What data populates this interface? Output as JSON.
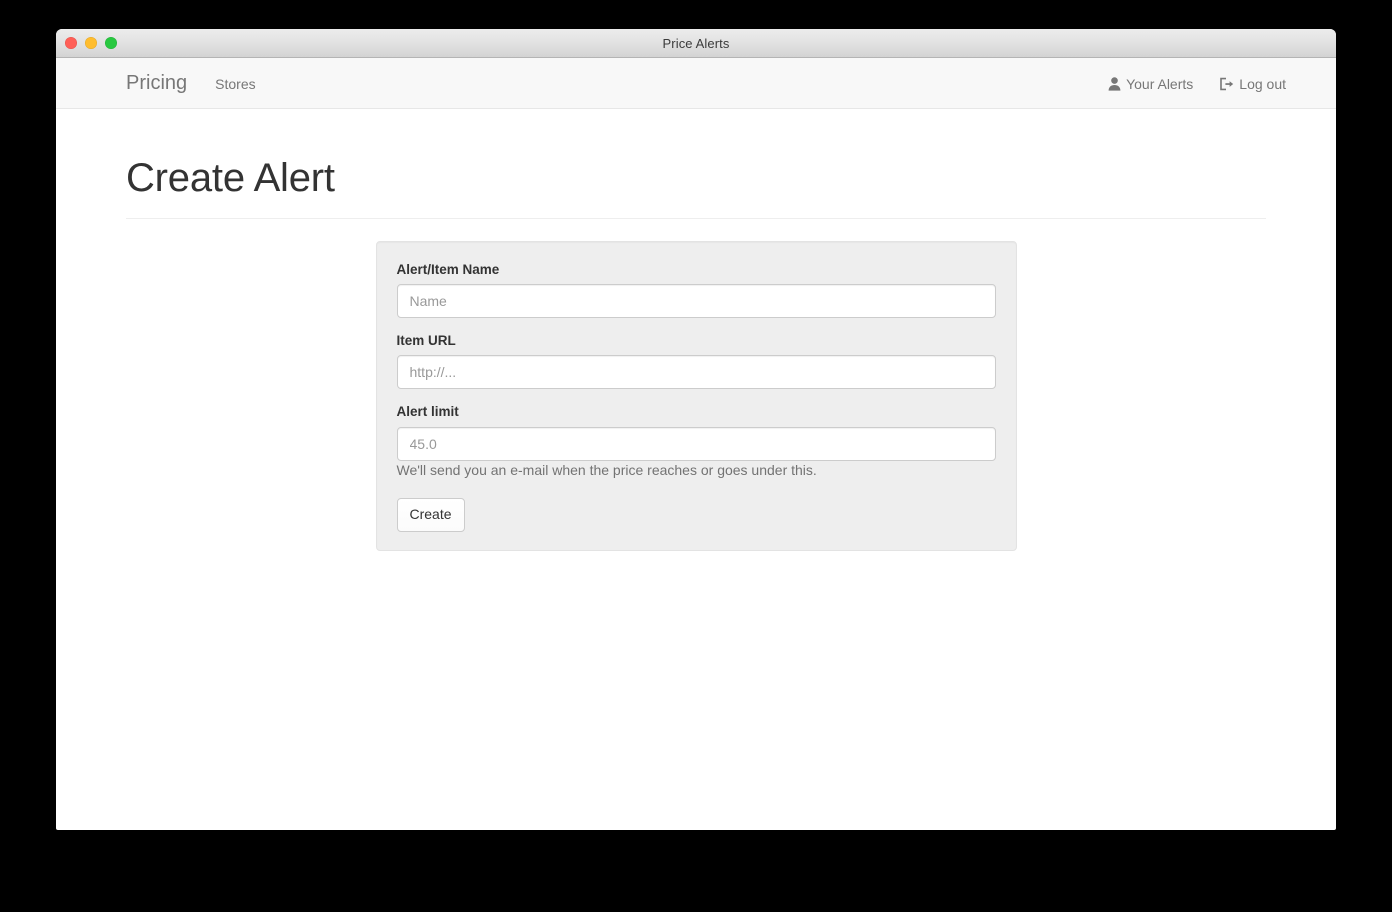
{
  "window": {
    "title": "Price Alerts",
    "traffic_lights": [
      {
        "name": "close",
        "color": "#ff5f57"
      },
      {
        "name": "minimize",
        "color": "#ffbd2e"
      },
      {
        "name": "zoom",
        "color": "#28c840"
      }
    ]
  },
  "navbar": {
    "brand": "Pricing",
    "links": [
      {
        "label": "Stores"
      }
    ],
    "right": [
      {
        "icon": "user-icon",
        "label": "Your Alerts"
      },
      {
        "icon": "sign-out-icon",
        "label": "Log out"
      }
    ]
  },
  "page": {
    "title": "Create Alert"
  },
  "form": {
    "fields": [
      {
        "label": "Alert/Item Name",
        "placeholder": "Name",
        "value": ""
      },
      {
        "label": "Item URL",
        "placeholder": "http://...",
        "value": ""
      },
      {
        "label": "Alert limit",
        "placeholder": "45.0",
        "value": "",
        "help": "We'll send you an e-mail when the price reaches or goes under this."
      }
    ],
    "submit_label": "Create"
  },
  "colors": {
    "page_background": "#ffffff",
    "navbar_background": "#f8f8f8",
    "panel_background": "#eeeeee",
    "text_muted": "#777777",
    "heading": "#333333",
    "desktop_background": "#000000"
  }
}
